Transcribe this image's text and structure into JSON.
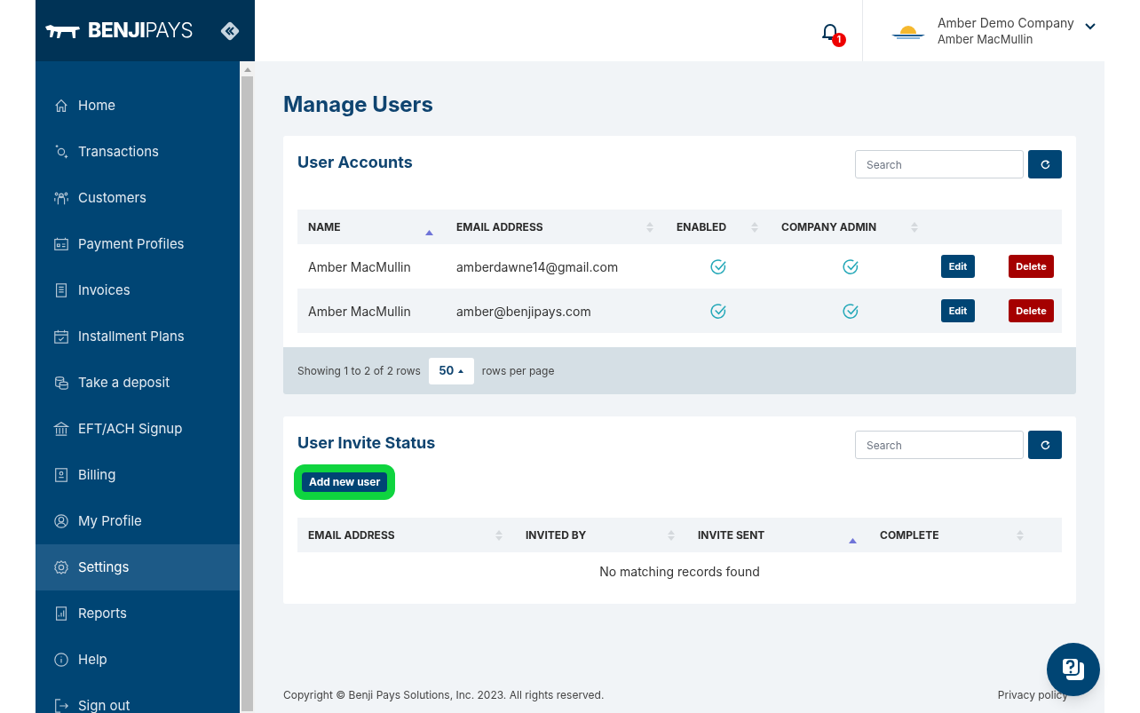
{
  "brand": {
    "logo": "**BENJI**PAYS"
  },
  "sidebar": {
    "items": [
      {
        "label": "Home",
        "selected": false
      },
      {
        "label": "Transactions",
        "selected": false
      },
      {
        "label": "Customers",
        "selected": false
      },
      {
        "label": "Payment Profiles",
        "selected": false
      },
      {
        "label": "Invoices",
        "selected": false
      },
      {
        "label": "Installment Plans",
        "selected": false
      },
      {
        "label": "Take a deposit",
        "selected": false
      },
      {
        "label": "EFT/ACH Signup",
        "selected": false
      },
      {
        "label": "Billing",
        "selected": false
      },
      {
        "label": "My Profile",
        "selected": false
      },
      {
        "label": "Settings",
        "selected": true
      },
      {
        "label": "Reports",
        "selected": false
      },
      {
        "label": "Help",
        "selected": false
      },
      {
        "label": "Sign out",
        "selected": false
      }
    ]
  },
  "header": {
    "notification_count": "1",
    "company": "Amber Demo Company",
    "user": "Amber MacMullin"
  },
  "page_title": "Manage Users",
  "user_accounts": {
    "title": "User Accounts",
    "search": {
      "placeholder": "Search"
    },
    "columns": [
      {
        "label": "NAME",
        "sorted": true
      },
      {
        "label": "EMAIL ADDRESS",
        "sorted": false
      },
      {
        "label": "ENABLED",
        "sorted": false
      },
      {
        "label": "COMPANY ADMIN",
        "sorted": false
      }
    ],
    "rows": [
      {
        "name": "Amber MacMullin",
        "email": "amberdawne14@gmail.com",
        "enabled": true,
        "company_admin": true,
        "edit": "Edit",
        "delete": "Delete"
      },
      {
        "name": "Amber MacMullin",
        "email": "amber@benjipays.com",
        "enabled": true,
        "company_admin": true,
        "edit": "Edit",
        "delete": "Delete"
      }
    ],
    "pagination": {
      "showing": "Showing 1 to 2 of 2 rows",
      "page_size": "50",
      "suffix": "rows per page"
    }
  },
  "invite_status": {
    "title": "User Invite Status",
    "search": {
      "placeholder": "Search"
    },
    "add_button": "Add new user",
    "columns": [
      {
        "label": "EMAIL ADDRESS",
        "sorted": false
      },
      {
        "label": "INVITED BY",
        "sorted": false
      },
      {
        "label": "INVITE SENT",
        "sorted": true
      },
      {
        "label": "COMPLETE",
        "sorted": false
      }
    ],
    "empty": "No matching records found"
  },
  "footer": {
    "copyright": "Copyright © Benji Pays Solutions, Inc. 2023. All rights reserved.",
    "privacy": "Privacy policy"
  }
}
